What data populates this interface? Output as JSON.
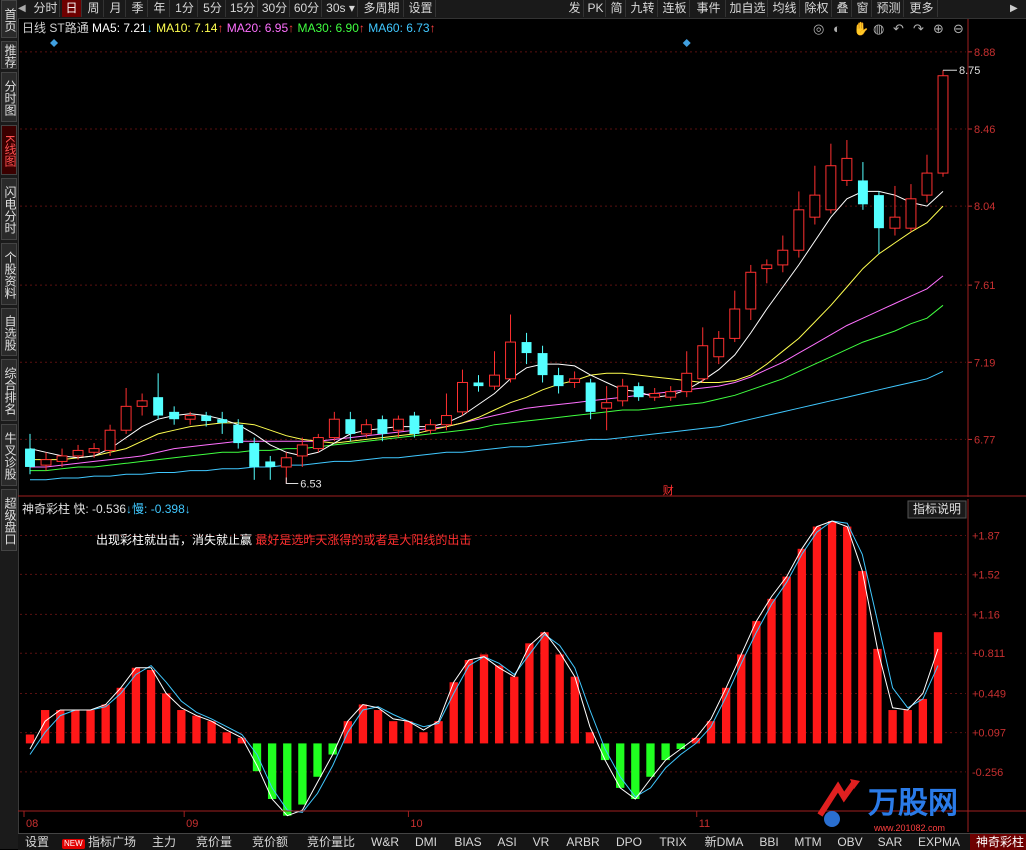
{
  "sidebar": {
    "items": [
      {
        "label": "首页",
        "active": false
      },
      {
        "label": "推荐",
        "active": false
      },
      {
        "label": "分时图",
        "active": false
      },
      {
        "label": "K线图",
        "active": true
      },
      {
        "label": "闪电分时",
        "active": false
      },
      {
        "label": "个股资料",
        "active": false
      },
      {
        "label": "自选股",
        "active": false
      },
      {
        "label": "综合排名",
        "active": false
      },
      {
        "label": "牛叉诊股",
        "active": false
      },
      {
        "label": "超级盘口",
        "active": false
      }
    ]
  },
  "toolbar": {
    "left": [
      "分时",
      "日",
      "周",
      "月",
      "季",
      "年",
      "1分",
      "5分",
      "15分",
      "30分",
      "60分",
      "30s",
      "多周期",
      "设置"
    ],
    "active": "日",
    "right": [
      "发",
      "PK",
      "简",
      "九转",
      "连板",
      "事件",
      "加自选",
      "均线",
      "除权",
      "叠",
      "窗",
      "预测",
      "更多"
    ]
  },
  "main": {
    "period_label": "日线",
    "stock_name": "ST路通",
    "ma": [
      {
        "label": "MA5:",
        "value": "7.21",
        "arrow": "↓",
        "color": "#ffffff"
      },
      {
        "label": "MA10:",
        "value": "7.14",
        "arrow": "↑",
        "color": "#ffff50"
      },
      {
        "label": "MA20:",
        "value": "6.95",
        "arrow": "↑",
        "color": "#ff70ff"
      },
      {
        "label": "MA30:",
        "value": "6.90",
        "arrow": "↑",
        "color": "#40ff40"
      },
      {
        "label": "MA60:",
        "value": "6.73",
        "arrow": "↑",
        "color": "#40c8ff"
      }
    ],
    "y_ticks": [
      "8.88",
      "8.46",
      "8.04",
      "7.61",
      "7.19",
      "6.77"
    ],
    "high_label": "8.75",
    "low_label": "6.53",
    "finance_marker": "财"
  },
  "indicator": {
    "name": "神奇彩柱",
    "fast_label": "快:",
    "fast_value": "-0.536",
    "slow_label": "慢:",
    "slow_value": "-0.398",
    "explain_button": "指标说明",
    "note_white": "出现彩柱就出击，消失就止赢",
    "note_red": "最好是选昨天涨得的或者是大阳线的出击",
    "y_ticks": [
      "+1.87",
      "+1.52",
      "+1.16",
      "+0.811",
      "+0.449",
      "+0.097",
      "-0.256"
    ],
    "bars": [
      0.08,
      0.3,
      0.3,
      0.3,
      0.3,
      0.35,
      0.5,
      0.68,
      0.66,
      0.45,
      0.3,
      0.25,
      0.2,
      0.1,
      0.05,
      -0.25,
      -0.5,
      -0.65,
      -0.55,
      -0.3,
      -0.1,
      0.2,
      0.35,
      0.3,
      0.2,
      0.2,
      0.1,
      0.2,
      0.55,
      0.75,
      0.8,
      0.7,
      0.6,
      0.9,
      1.0,
      0.8,
      0.6,
      0.1,
      -0.15,
      -0.4,
      -0.5,
      -0.3,
      -0.15,
      -0.05,
      0.05,
      0.2,
      0.5,
      0.8,
      1.1,
      1.3,
      1.5,
      1.75,
      1.95,
      2.0,
      1.95,
      1.55,
      0.85,
      0.3,
      0.3,
      0.4,
      1.0
    ],
    "fast": [
      -0.05,
      0.2,
      0.3,
      0.3,
      0.3,
      0.35,
      0.5,
      0.68,
      0.68,
      0.45,
      0.32,
      0.25,
      0.2,
      0.12,
      0.05,
      -0.2,
      -0.5,
      -0.65,
      -0.6,
      -0.35,
      -0.1,
      0.2,
      0.35,
      0.32,
      0.22,
      0.2,
      0.12,
      0.2,
      0.55,
      0.75,
      0.78,
      0.68,
      0.6,
      0.88,
      1.0,
      0.82,
      0.6,
      0.15,
      -0.15,
      -0.4,
      -0.5,
      -0.32,
      -0.15,
      -0.05,
      0.05,
      0.22,
      0.5,
      0.8,
      1.1,
      1.32,
      1.5,
      1.75,
      1.95,
      2.0,
      1.95,
      1.55,
      0.85,
      0.32,
      0.3,
      0.45,
      0.85
    ],
    "slow": [
      -0.1,
      0.1,
      0.25,
      0.3,
      0.3,
      0.33,
      0.45,
      0.62,
      0.7,
      0.55,
      0.38,
      0.28,
      0.22,
      0.15,
      0.08,
      -0.1,
      -0.4,
      -0.6,
      -0.62,
      -0.45,
      -0.2,
      0.1,
      0.3,
      0.33,
      0.26,
      0.2,
      0.15,
      0.18,
      0.45,
      0.7,
      0.78,
      0.72,
      0.62,
      0.8,
      0.98,
      0.88,
      0.68,
      0.3,
      -0.05,
      -0.3,
      -0.48,
      -0.4,
      -0.22,
      -0.1,
      0.0,
      0.15,
      0.42,
      0.72,
      1.0,
      1.25,
      1.45,
      1.7,
      1.9,
      2.0,
      1.98,
      1.7,
      1.1,
      0.5,
      0.32,
      0.4,
      0.7
    ]
  },
  "chart_data": {
    "type": "candlestick",
    "y_range": [
      6.5,
      8.95
    ],
    "months": [
      {
        "label": "08",
        "index": 0
      },
      {
        "label": "09",
        "index": 10
      },
      {
        "label": "10",
        "index": 24
      },
      {
        "label": "11",
        "index": 42
      }
    ],
    "candles": [
      [
        6.72,
        6.62,
        6.8,
        6.58
      ],
      [
        6.63,
        6.66,
        6.7,
        6.6
      ],
      [
        6.65,
        6.68,
        6.72,
        6.62
      ],
      [
        6.68,
        6.71,
        6.74,
        6.66
      ],
      [
        6.7,
        6.72,
        6.75,
        6.67
      ],
      [
        6.71,
        6.82,
        6.85,
        6.68
      ],
      [
        6.82,
        6.95,
        7.05,
        6.8
      ],
      [
        6.95,
        6.98,
        7.02,
        6.9
      ],
      [
        7.0,
        6.9,
        7.13,
        6.88
      ],
      [
        6.92,
        6.88,
        6.95,
        6.85
      ],
      [
        6.88,
        6.9,
        6.92,
        6.85
      ],
      [
        6.9,
        6.87,
        6.92,
        6.84
      ],
      [
        6.88,
        6.86,
        6.92,
        6.8
      ],
      [
        6.85,
        6.75,
        6.88,
        6.72
      ],
      [
        6.75,
        6.62,
        6.78,
        6.55
      ],
      [
        6.65,
        6.62,
        6.68,
        6.55
      ],
      [
        6.62,
        6.67,
        6.7,
        6.53
      ],
      [
        6.68,
        6.74,
        6.78,
        6.62
      ],
      [
        6.72,
        6.78,
        6.8,
        6.7
      ],
      [
        6.78,
        6.88,
        6.92,
        6.76
      ],
      [
        6.88,
        6.8,
        6.92,
        6.76
      ],
      [
        6.8,
        6.85,
        6.88,
        6.78
      ],
      [
        6.88,
        6.8,
        6.9,
        6.76
      ],
      [
        6.82,
        6.88,
        6.9,
        6.78
      ],
      [
        6.9,
        6.8,
        6.92,
        6.78
      ],
      [
        6.82,
        6.85,
        6.88,
        6.8
      ],
      [
        6.85,
        6.9,
        7.02,
        6.82
      ],
      [
        6.92,
        7.08,
        7.15,
        6.9
      ],
      [
        7.08,
        7.06,
        7.12,
        7.03
      ],
      [
        7.06,
        7.12,
        7.25,
        7.04
      ],
      [
        7.1,
        7.3,
        7.45,
        7.08
      ],
      [
        7.3,
        7.24,
        7.35,
        7.18
      ],
      [
        7.24,
        7.12,
        7.28,
        7.08
      ],
      [
        7.12,
        7.06,
        7.16,
        7.02
      ],
      [
        7.08,
        7.1,
        7.14,
        7.05
      ],
      [
        7.08,
        6.92,
        7.1,
        6.88
      ],
      [
        6.94,
        6.97,
        7.06,
        6.82
      ],
      [
        6.98,
        7.06,
        7.1,
        6.95
      ],
      [
        7.06,
        7.0,
        7.08,
        6.98
      ],
      [
        7.0,
        7.02,
        7.05,
        6.98
      ],
      [
        7.0,
        7.03,
        7.06,
        6.98
      ],
      [
        7.03,
        7.13,
        7.25,
        7.0
      ],
      [
        7.1,
        7.28,
        7.38,
        7.08
      ],
      [
        7.22,
        7.32,
        7.36,
        7.18
      ],
      [
        7.32,
        7.48,
        7.58,
        7.3
      ],
      [
        7.48,
        7.68,
        7.72,
        7.42
      ],
      [
        7.7,
        7.72,
        7.75,
        7.62
      ],
      [
        7.72,
        7.8,
        7.88,
        7.68
      ],
      [
        7.8,
        8.02,
        8.12,
        7.76
      ],
      [
        7.98,
        8.1,
        8.26,
        7.94
      ],
      [
        8.02,
        8.26,
        8.38,
        8.0
      ],
      [
        8.18,
        8.3,
        8.4,
        8.15
      ],
      [
        8.18,
        8.05,
        8.28,
        8.02
      ],
      [
        8.1,
        7.92,
        8.12,
        7.78
      ],
      [
        7.92,
        7.98,
        8.15,
        7.88
      ],
      [
        7.92,
        8.08,
        8.16,
        7.9
      ],
      [
        8.1,
        8.22,
        8.32,
        8.06
      ],
      [
        8.22,
        8.75,
        8.78,
        8.2
      ]
    ],
    "ma5": [
      6.72,
      6.7,
      6.68,
      6.67,
      6.68,
      6.72,
      6.78,
      6.84,
      6.88,
      6.9,
      6.91,
      6.9,
      6.88,
      6.85,
      6.8,
      6.74,
      6.7,
      6.68,
      6.7,
      6.75,
      6.8,
      6.82,
      6.83,
      6.84,
      6.84,
      6.84,
      6.86,
      6.9,
      6.96,
      7.02,
      7.1,
      7.16,
      7.18,
      7.18,
      7.17,
      7.12,
      7.08,
      7.04,
      7.03,
      7.0,
      7.01,
      7.04,
      7.09,
      7.15,
      7.23,
      7.35,
      7.48,
      7.6,
      7.72,
      7.85,
      7.98,
      8.08,
      8.12,
      8.12,
      8.1,
      8.06,
      8.04,
      8.12
    ],
    "ma10": [
      6.66,
      6.66,
      6.66,
      6.67,
      6.68,
      6.7,
      6.72,
      6.76,
      6.8,
      6.82,
      6.84,
      6.85,
      6.86,
      6.86,
      6.85,
      6.82,
      6.79,
      6.77,
      6.76,
      6.75,
      6.76,
      6.77,
      6.78,
      6.79,
      6.8,
      6.82,
      6.84,
      6.86,
      6.89,
      6.93,
      6.97,
      7.0,
      7.04,
      7.07,
      7.09,
      7.12,
      7.13,
      7.13,
      7.12,
      7.11,
      7.1,
      7.09,
      7.08,
      7.08,
      7.09,
      7.12,
      7.18,
      7.25,
      7.32,
      7.41,
      7.5,
      7.6,
      7.7,
      7.78,
      7.84,
      7.9,
      7.95,
      8.04
    ],
    "ma20": [
      6.62,
      6.62,
      6.63,
      6.64,
      6.65,
      6.66,
      6.67,
      6.68,
      6.7,
      6.72,
      6.73,
      6.74,
      6.75,
      6.76,
      6.76,
      6.76,
      6.76,
      6.76,
      6.76,
      6.77,
      6.78,
      6.79,
      6.8,
      6.81,
      6.82,
      6.83,
      6.84,
      6.86,
      6.88,
      6.9,
      6.92,
      6.94,
      6.95,
      6.96,
      6.97,
      6.98,
      6.99,
      7.0,
      7.01,
      7.02,
      7.03,
      7.04,
      7.05,
      7.06,
      7.08,
      7.11,
      7.15,
      7.19,
      7.24,
      7.29,
      7.34,
      7.39,
      7.43,
      7.47,
      7.51,
      7.55,
      7.59,
      7.66
    ],
    "ma30": [
      6.6,
      6.6,
      6.61,
      6.62,
      6.62,
      6.63,
      6.64,
      6.65,
      6.66,
      6.67,
      6.68,
      6.69,
      6.7,
      6.7,
      6.71,
      6.71,
      6.72,
      6.72,
      6.73,
      6.74,
      6.75,
      6.76,
      6.77,
      6.78,
      6.79,
      6.8,
      6.81,
      6.82,
      6.83,
      6.85,
      6.86,
      6.87,
      6.88,
      6.89,
      6.9,
      6.91,
      6.92,
      6.93,
      6.93,
      6.94,
      6.95,
      6.96,
      6.97,
      6.99,
      7.01,
      7.04,
      7.07,
      7.1,
      7.14,
      7.18,
      7.22,
      7.26,
      7.3,
      7.33,
      7.36,
      7.4,
      7.43,
      7.5
    ],
    "ma60": [
      6.55,
      6.55,
      6.56,
      6.56,
      6.57,
      6.57,
      6.58,
      6.58,
      6.59,
      6.59,
      6.6,
      6.6,
      6.61,
      6.61,
      6.62,
      6.62,
      6.63,
      6.63,
      6.64,
      6.65,
      6.65,
      6.66,
      6.67,
      6.67,
      6.68,
      6.69,
      6.7,
      6.7,
      6.71,
      6.72,
      6.73,
      6.73,
      6.74,
      6.75,
      6.76,
      6.77,
      6.77,
      6.78,
      6.79,
      6.8,
      6.81,
      6.82,
      6.83,
      6.84,
      6.86,
      6.88,
      6.9,
      6.92,
      6.94,
      6.96,
      6.98,
      7.0,
      7.02,
      7.04,
      7.06,
      7.08,
      7.1,
      7.14
    ]
  },
  "bottom_tabs": [
    "设置",
    "指标广场",
    "主力",
    "竞价量",
    "竞价额",
    "竞价量比",
    "W&R",
    "DMI",
    "BIAS",
    "ASI",
    "VR",
    "ARBR",
    "DPO",
    "TRIX",
    "新DMA",
    "BBI",
    "MTM",
    "OBV",
    "SAR",
    "EXPMA",
    "神奇彩柱"
  ],
  "bottom_active": "神奇彩柱",
  "bottom_new_badge": "NEW",
  "logo": {
    "name": "万股网",
    "url_text": "www.201082.com"
  }
}
